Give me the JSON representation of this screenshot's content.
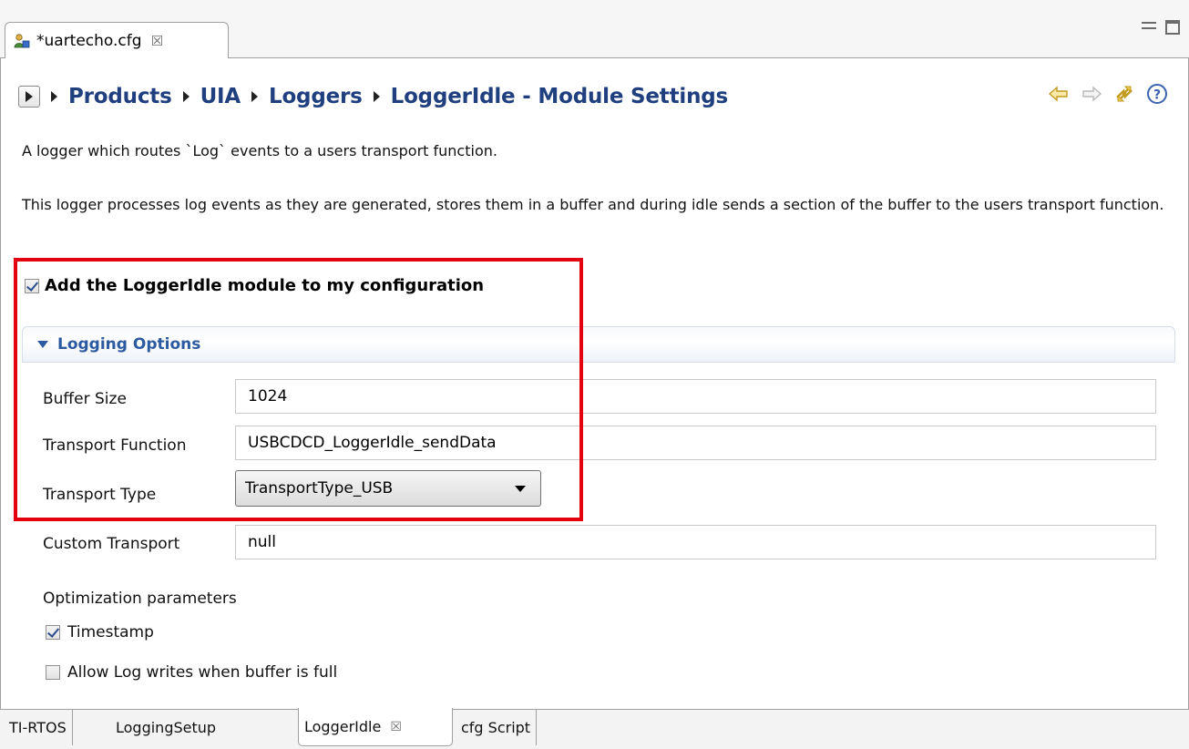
{
  "editor_tab": {
    "label": "*uartecho.cfg",
    "icon": "config-file-icon",
    "close_glyph": "☒"
  },
  "breadcrumb": {
    "items": [
      "Products",
      "UIA",
      "Loggers"
    ],
    "title": "LoggerIdle - Module Settings"
  },
  "nav": {
    "back_icon": "back-arrow-icon",
    "forward_icon": "forward-arrow-icon",
    "sync_icon": "sync-icon",
    "help_icon": "help-icon"
  },
  "description": {
    "line1": "A logger which routes `Log` events to a users transport function.",
    "line2": "This logger processes log events as they are generated, stores them in a buffer and during idle sends a section of the buffer to the users transport function."
  },
  "add_module": {
    "label": "Add the LoggerIdle module to my configuration",
    "checked": true
  },
  "section": {
    "title": "Logging Options"
  },
  "form": {
    "buffer_size": {
      "label": "Buffer Size",
      "value": "1024"
    },
    "transport_function": {
      "label": "Transport Function",
      "value": "USBCDCD_LoggerIdle_sendData"
    },
    "transport_type": {
      "label": "Transport Type",
      "value": "TransportType_USB"
    },
    "custom_transport": {
      "label": "Custom Transport",
      "value": "null"
    }
  },
  "optimization": {
    "title": "Optimization parameters",
    "timestamp": {
      "label": "Timestamp",
      "checked": true
    },
    "allow_full": {
      "label": "Allow Log writes when buffer is full",
      "checked": false
    }
  },
  "bottom_tabs": [
    {
      "label": "TI-RTOS"
    },
    {
      "label": "LoggingSetup"
    },
    {
      "label": "LoggerIdle",
      "active": true
    },
    {
      "label": "cfg Script"
    }
  ],
  "colors": {
    "highlight": "#e3000f",
    "breadcrumb": "#1f3f7f",
    "section_title": "#2c5aa0"
  }
}
